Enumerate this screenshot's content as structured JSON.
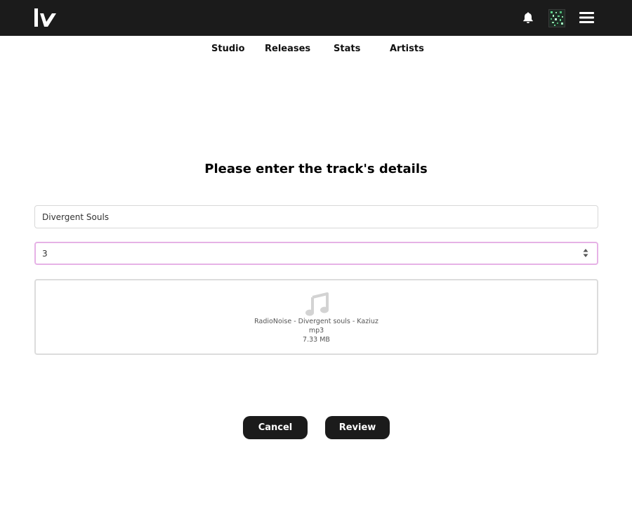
{
  "header": {
    "logo_icon": "brand-logo-icon",
    "notification_icon": "bell-icon",
    "avatar_icon": "user-avatar",
    "menu_icon": "hamburger-menu-icon",
    "background_color": "#1b1b1b"
  },
  "nav": {
    "items": [
      {
        "label": "Studio"
      },
      {
        "label": "Releases"
      },
      {
        "label": "Stats"
      },
      {
        "label": "Artists"
      }
    ]
  },
  "form": {
    "heading": "Please enter the track's details",
    "title_value": "Divergent Souls",
    "number_value": "3",
    "focus_color": "#e6b2e6",
    "file": {
      "icon": "music-note-icon",
      "name": "RadioNoise - Divergent souls - Kaziuz",
      "type": "mp3",
      "size": "7.33 MB"
    }
  },
  "actions": {
    "cancel_label": "Cancel",
    "review_label": "Review",
    "button_color": "#1b1b1b"
  }
}
